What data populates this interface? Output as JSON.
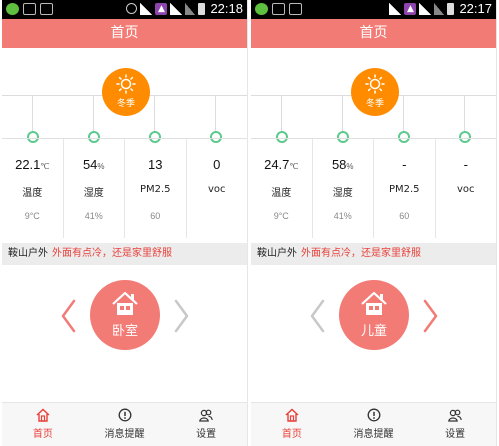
{
  "colors": {
    "accent": "#f37b76",
    "season": "#ff8c00",
    "node": "#5cc98d",
    "warning": "#e8403a"
  },
  "screens": [
    {
      "status_time": "22:18",
      "title": "首页",
      "season": "冬季",
      "readings": [
        {
          "value": "22.1",
          "unit": "℃",
          "label": "温度",
          "sub": "9°C"
        },
        {
          "value": "54",
          "unit": "%",
          "label": "湿度",
          "sub": "41%"
        },
        {
          "value": "13",
          "unit": "",
          "label": "PM2.5",
          "sub": "60"
        },
        {
          "value": "0",
          "unit": "",
          "label": "voc",
          "sub": ""
        }
      ],
      "tip_location": "鞍山户外",
      "tip_message": "外面有点冷，还是家里舒服",
      "room_name": "卧室",
      "left_arrow_active": true,
      "right_arrow_active": false,
      "nav": [
        {
          "label": "首页",
          "icon": "home-icon",
          "active": true
        },
        {
          "label": "消息提醒",
          "icon": "alert-icon"
        },
        {
          "label": "设置",
          "icon": "users-icon"
        }
      ]
    },
    {
      "status_time": "22:17",
      "title": "首页",
      "season": "冬季",
      "readings": [
        {
          "value": "24.7",
          "unit": "℃",
          "label": "温度",
          "sub": "9°C"
        },
        {
          "value": "58",
          "unit": "%",
          "label": "湿度",
          "sub": "41%"
        },
        {
          "value": "-",
          "unit": "",
          "label": "PM2.5",
          "sub": "60"
        },
        {
          "value": "-",
          "unit": "",
          "label": "voc",
          "sub": ""
        }
      ],
      "tip_location": "鞍山户外",
      "tip_message": "外面有点冷，还是家里舒服",
      "room_name": "儿童",
      "left_arrow_active": false,
      "right_arrow_active": true,
      "nav": [
        {
          "label": "首页",
          "icon": "home-icon",
          "active": true
        },
        {
          "label": "消息提醒",
          "icon": "alert-icon"
        },
        {
          "label": "设置",
          "icon": "users-icon"
        }
      ]
    }
  ]
}
